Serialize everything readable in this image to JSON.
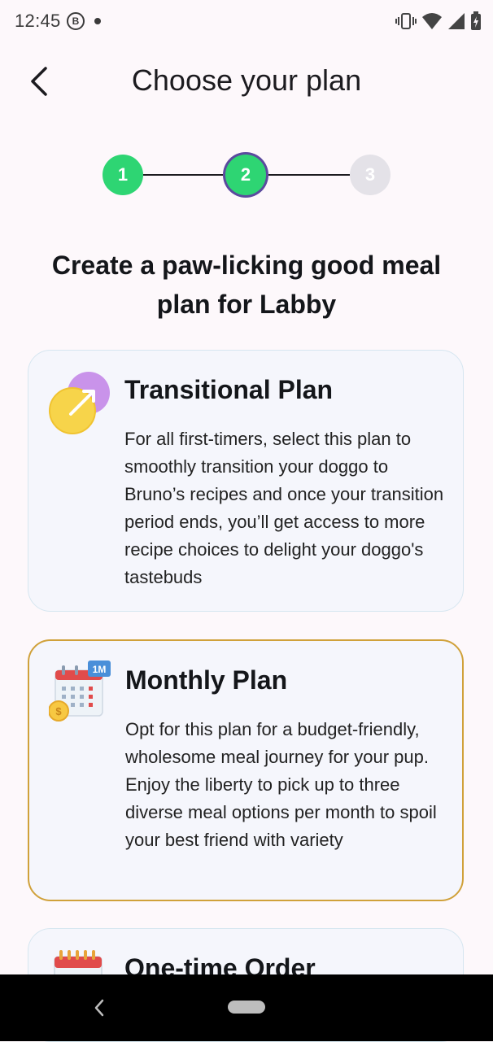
{
  "status_bar": {
    "time": "12:45",
    "badge": "B"
  },
  "header": {
    "title": "Choose your plan"
  },
  "stepper": {
    "steps": [
      "1",
      "2",
      "3"
    ],
    "current": 2
  },
  "headline": "Create a paw-licking good meal plan for Labby",
  "plans": [
    {
      "title": "Transitional Plan",
      "description": "For all first-timers, select this plan to smoothly transition your doggo to Bruno’s recipes and once your transition period ends, you’ll get access to more recipe choices to delight your doggo's tastebuds",
      "icon": "transition-icon",
      "selected": false
    },
    {
      "title": "Monthly Plan",
      "icon_badge": "1M",
      "description": "Opt for this plan for a budget-friendly, wholesome meal journey for your pup. Enjoy the liberty to pick up to three diverse meal options per month to spoil your best friend with variety",
      "icon": "calendar-icon",
      "selected": true
    },
    {
      "title": "One-time Order",
      "description": "",
      "icon": "calendar-icon",
      "selected": false
    }
  ],
  "colors": {
    "background": "#fdf8fb",
    "step_green": "#2ed573",
    "step_ring": "#5b4a9e",
    "selected_border": "#d0a13a",
    "card_bg": "#f5f6fc"
  }
}
